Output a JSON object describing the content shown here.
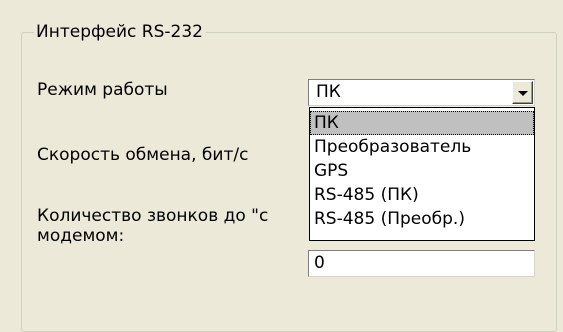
{
  "group": {
    "title": "Интерфейс RS-232"
  },
  "fields": {
    "mode_label": "Режим работы",
    "speed_label": "Скорость обмена, бит/с",
    "rings_label_line1": "Количество звонков до \"с",
    "rings_label_line2": "модемом:"
  },
  "mode_combo": {
    "value": "ПК",
    "options": [
      "ПК",
      "Преобразователь",
      "GPS",
      "RS-485 (ПК)",
      "RS-485 (Преобр.)"
    ],
    "selected_index": 0
  },
  "rings_input": {
    "value": "0"
  },
  "icons": {
    "dropdown_arrow": "chevron-down-icon"
  }
}
